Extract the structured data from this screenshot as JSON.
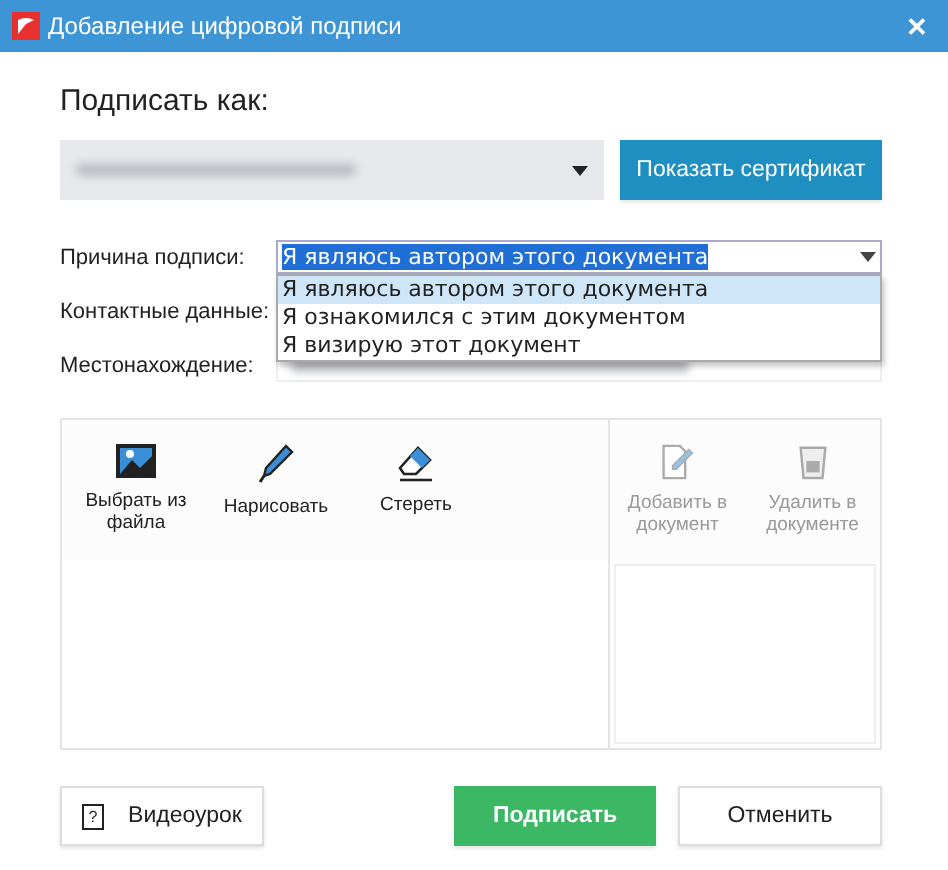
{
  "window": {
    "title": "Добавление цифровой подписи",
    "close": "✕"
  },
  "sign_as": {
    "label": "Подписать как:",
    "show_certificate": "Показать сертификат"
  },
  "fields": [
    {
      "kind": "combo",
      "label": "Причина подписи:",
      "value": "Я являюсь автором этого документа",
      "expanded": true,
      "options": [
        {
          "label": "Я являюсь автором этого документа",
          "selected": true
        },
        {
          "label": "Я ознакомился с этим документом",
          "selected": false
        },
        {
          "label": "Я визирую этот документ",
          "selected": false
        }
      ]
    },
    {
      "kind": "text",
      "label": "Контактные данные:"
    },
    {
      "kind": "blurred",
      "label": "Местонахождение:"
    }
  ],
  "tools": [
    {
      "kind": "image",
      "label": "Выбрать из файла",
      "disabled": false
    },
    {
      "kind": "pen",
      "label": "Нарисовать",
      "disabled": false
    },
    {
      "kind": "eraser",
      "label": "Стереть",
      "disabled": false
    }
  ],
  "doc_tools": [
    {
      "kind": "add",
      "label": "Добавить в документ",
      "disabled": true
    },
    {
      "kind": "trash",
      "label": "Удалить в документе",
      "disabled": true
    }
  ],
  "buttons": [
    {
      "kind": "video",
      "label": "Видеоурок",
      "icon": "?"
    },
    {
      "kind": "primary",
      "label": "Подписать"
    },
    {
      "kind": "cancel",
      "label": "Отменить"
    }
  ]
}
